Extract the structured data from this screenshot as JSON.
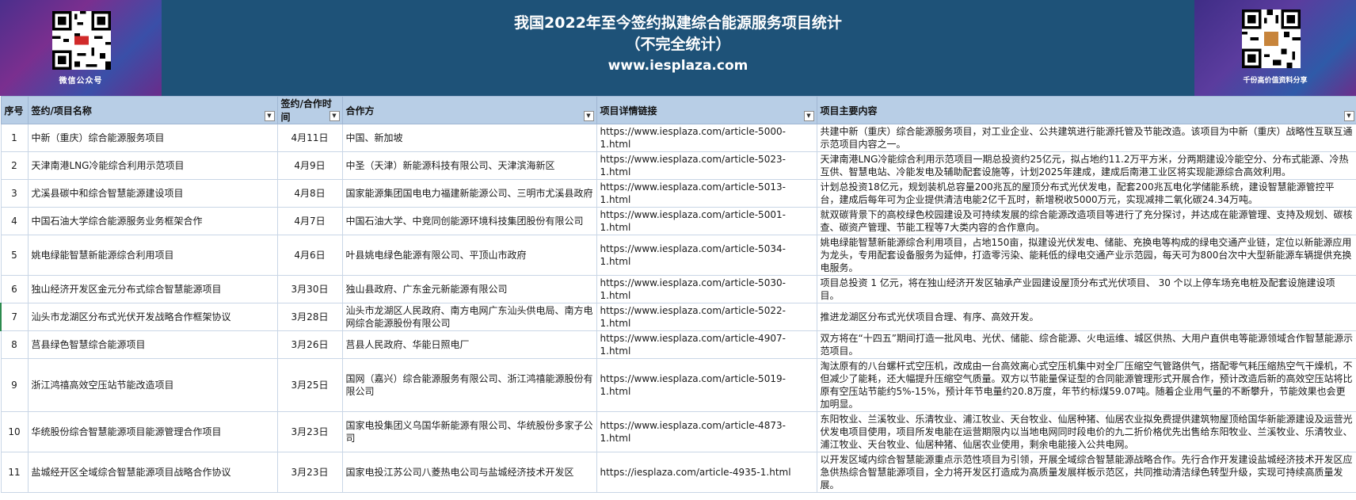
{
  "banner": {
    "title_line1": "我国2022年至今签约拟建综合能源服务项目统计",
    "title_line2": "（不完全统计）",
    "title_line3": "www.iesplaza.com",
    "left_qr_caption": "微信公众号",
    "right_qr_caption": "千份高价值资料分享",
    "colors": {
      "header_bg": "#1e5278",
      "column_header_bg": "#b8cee6"
    }
  },
  "columns": [
    "序号",
    "签约/项目名称",
    "签约/合作时间",
    "合作方",
    "项目详情链接",
    "项目主要内容"
  ],
  "rows": [
    {
      "no": "1",
      "name": "中新（重庆）综合能源服务项目",
      "date": "4月11日",
      "partner": "中国、新加坡",
      "link": "https://www.iesplaza.com/article-5000-1.html",
      "content": "共建中新（重庆）综合能源服务项目，对工业企业、公共建筑进行能源托管及节能改造。该项目为中新（重庆）战略性互联互通示范项目内容之一。"
    },
    {
      "no": "2",
      "name": "天津南港LNG冷能综合利用示范项目",
      "date": "4月9日",
      "partner": "中圣（天津）新能源科技有限公司、天津滨海新区",
      "link": "https://www.iesplaza.com/article-5023-1.html",
      "content": "天津南港LNG冷能综合利用示范项目一期总投资约25亿元，拟占地约11.2万平方米，分两期建设冷能空分、分布式能源、冷热互供、智慧电站、冷能发电及辅助配套设施等，计划2025年建成，建成后南港工业区将实现能源综合高效利用。"
    },
    {
      "no": "3",
      "name": "尤溪县碳中和综合智慧能源建设项目",
      "date": "4月8日",
      "partner": "国家能源集团国电电力福建新能源公司、三明市尤溪县政府",
      "link": "https://www.iesplaza.com/article-5013-1.html",
      "content": "计划总投资18亿元，规划装机总容量200兆瓦的屋顶分布式光伏发电，配套200兆瓦电化学储能系统，建设智慧能源管控平台，建成后每年可为企业提供清洁电能2亿千瓦时，新增税收5000万元，实现减排二氧化碳24.34万吨。"
    },
    {
      "no": "4",
      "name": "中国石油大学综合能源服务业务框架合作",
      "date": "4月7日",
      "partner": "中国石油大学、中竞同创能源环境科技集团股份有限公司",
      "link": "https://www.iesplaza.com/article-5001-1.html",
      "content": "就双碳背景下的高校绿色校园建设及可持续发展的综合能源改造项目等进行了充分探讨，并达成在能源管理、支持及规划、碳核查、碳资产管理、节能工程等7大类内容的合作意向。"
    },
    {
      "no": "5",
      "name": "姚电绿能智慧新能源综合利用项目",
      "date": "4月6日",
      "partner": "叶县姚电绿色能源有限公司、平顶山市政府",
      "link": "https://www.iesplaza.com/article-5034-1.html",
      "content": "姚电绿能智慧新能源综合利用项目，占地150亩，拟建设光伏发电、储能、充换电等构成的绿电交通产业链，定位以新能源应用为龙头，专用配套设备服务为延伸，打造零污染、能耗低的绿电交通产业示范园，每天可为800台次中大型新能源车辆提供充换电服务。"
    },
    {
      "no": "6",
      "name": "独山经济开发区金元分布式综合智慧能源项目",
      "date": "3月30日",
      "partner": "独山县政府、广东金元新能源有限公司",
      "link": "https://www.iesplaza.com/article-5030-1.html",
      "content": "项目总投资 1 亿元，将在独山经济开发区轴承产业园建设屋顶分布式光伏项目、 30 个以上停车场充电桩及配套设施建设项目。"
    },
    {
      "no": "7",
      "name": "汕头市龙湖区分布式光伏开发战略合作框架协议",
      "date": "3月28日",
      "partner": "汕头市龙湖区人民政府、南方电网广东汕头供电局、南方电网综合能源股份有限公司",
      "link": "https://www.iesplaza.com/article-5022-1.html",
      "content": "推进龙湖区分布式光伏项目合理、有序、高效开发。"
    },
    {
      "no": "8",
      "name": "莒县绿色智慧综合能源项目",
      "date": "3月26日",
      "partner": "莒县人民政府、华能日照电厂",
      "link": "https://www.iesplaza.com/article-4907-1.html",
      "content": "双方将在“十四五”期间打造一批风电、光伏、储能、综合能源、火电运维、城区供热、大用户直供电等能源领域合作智慧能源示范项目。"
    },
    {
      "no": "9",
      "name": "浙江鸿禧高效空压站节能改造项目",
      "date": "3月25日",
      "partner": "国网（嘉兴）综合能源服务有限公司、浙江鸿禧能源股份有限公司",
      "link": "https://www.iesplaza.com/article-5019-1.html",
      "content": "淘汰原有的八台螺杆式空压机，改成由一台高效离心式空压机集中对全厂压缩空气管路供气，搭配零气耗压缩热空气干燥机，不但减少了能耗，还大幅提升压缩空气质量。双方以节能量保证型的合同能源管理形式开展合作，预计改造后新的高效空压站将比原有空压站节能约5%-15%，预计年节电量约20.8万度，年节约标煤59.07吨。随着企业用气量的不断攀升，节能效果也会更加明显。"
    },
    {
      "no": "10",
      "name": "华统股份综合智慧能源项目能源管理合作项目",
      "date": "3月23日",
      "partner": "国家电投集团义乌国华新能源有限公司、华统股份多家子公司",
      "link": "https://www.iesplaza.com/article-4873-1.html",
      "content": "东阳牧业、兰溪牧业、乐清牧业、浦江牧业、天台牧业、仙居种猪、仙居农业拟免费提供建筑物屋顶给国华新能源建设及运营光伏发电项目使用，项目所发电能在运营期限内以当地电网同时段电价的九二折价格优先出售给东阳牧业、兰溪牧业、乐清牧业、浦江牧业、天台牧业、仙居种猪、仙居农业使用，剩余电能接入公共电网。"
    },
    {
      "no": "11",
      "name": "盐城经开区全域综合智慧能源项目战略合作协议",
      "date": "3月23日",
      "partner": "国家电投江苏公司八菱热电公司与盐城经济技术开发区",
      "link": "https://iesplaza.com/article-4935-1.html",
      "content": "以开发区域内综合智慧能源重点示范性项目为引领，开展全域综合智慧能源战略合作。先行合作开发建设盐城经济技术开发区应急供热综合智慧能源项目，全力将开发区打造成为高质量发展样板示范区，共同推动清洁绿色转型升级，实现可持续高质量发展。"
    }
  ]
}
